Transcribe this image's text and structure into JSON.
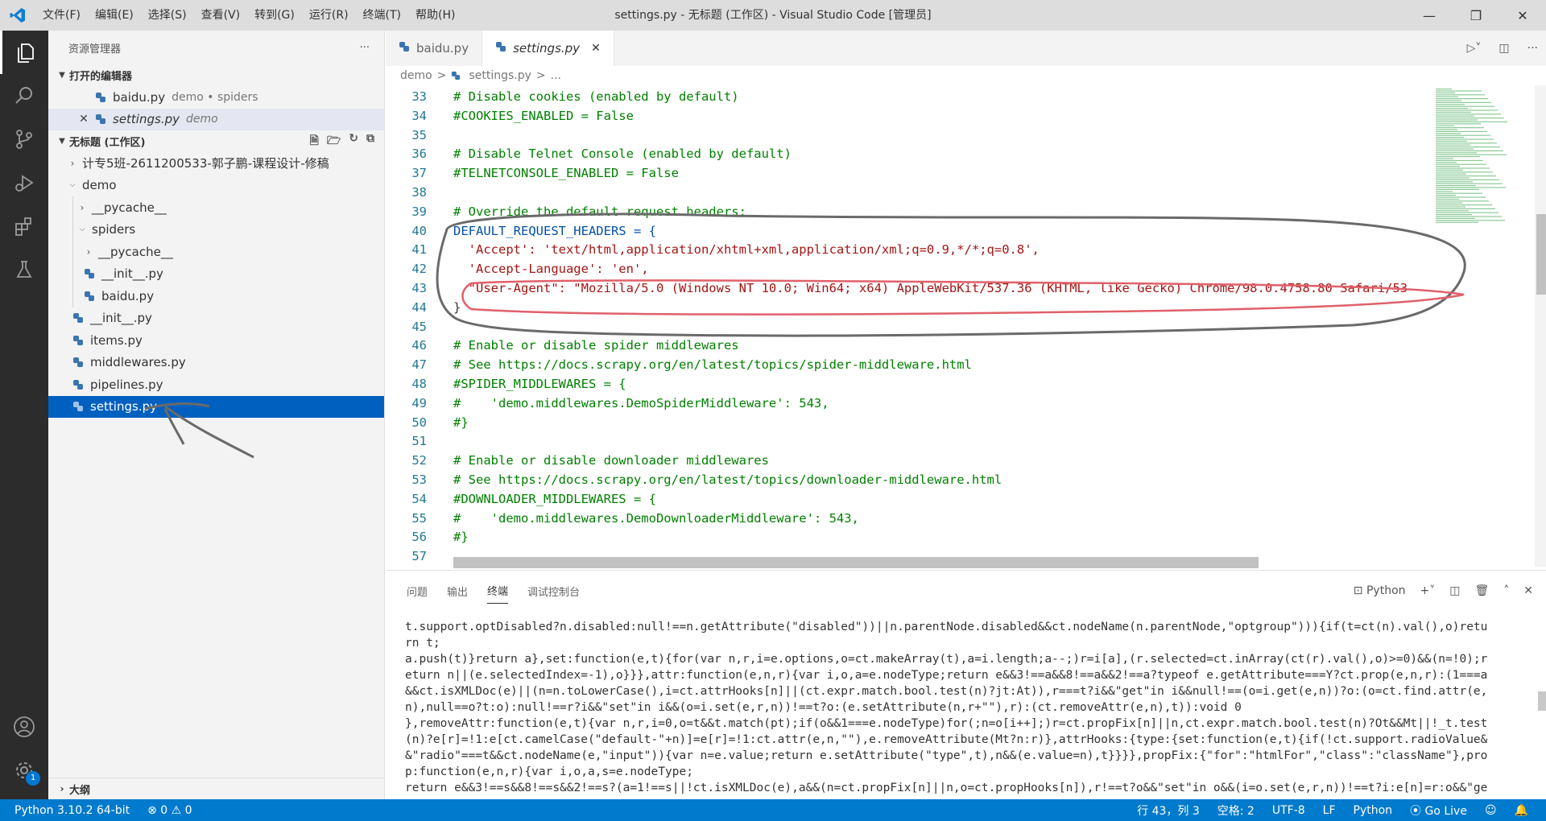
{
  "titlebar": {
    "menu": [
      "文件(F)",
      "编辑(E)",
      "选择(S)",
      "查看(V)",
      "转到(G)",
      "运行(R)",
      "终端(T)",
      "帮助(H)"
    ],
    "title": "settings.py - 无标题 (工作区) - Visual Studio Code [管理员]"
  },
  "activitybar": {
    "settings_badge": "1"
  },
  "sidebar": {
    "title": "资源管理器",
    "more": "···",
    "open_editors": {
      "header": "打开的编辑器",
      "items": [
        {
          "name": "baidu.py",
          "desc": "demo • spiders"
        },
        {
          "name": "settings.py",
          "desc": "demo"
        }
      ]
    },
    "workspace": {
      "header": "无标题 (工作区)",
      "items": [
        "计专5班-2611200533-郭子鹏-课程设计-修稿",
        "demo",
        "__pycache__",
        "spiders",
        "__pycache__",
        "__init__.py",
        "baidu.py",
        "__init__.py",
        "items.py",
        "middlewares.py",
        "pipelines.py",
        "settings.py"
      ]
    },
    "outline": "大纲"
  },
  "editor": {
    "tabs": [
      {
        "label": "baidu.py"
      },
      {
        "label": "settings.py",
        "close": "✕"
      }
    ],
    "breadcrumb": [
      "demo",
      ">",
      "settings.py",
      ">",
      "..."
    ],
    "lines": [
      {
        "n": "33",
        "t": "# Disable cookies (enabled by default)",
        "k": "cm"
      },
      {
        "n": "34",
        "t": "#COOKIES_ENABLED = False",
        "k": "cm"
      },
      {
        "n": "35",
        "t": "",
        "k": "cm"
      },
      {
        "n": "36",
        "t": "# Disable Telnet Console (enabled by default)",
        "k": "cm"
      },
      {
        "n": "37",
        "t": "#TELNETCONSOLE_ENABLED = False",
        "k": "cm"
      },
      {
        "n": "38",
        "t": "",
        "k": "cm"
      },
      {
        "n": "39",
        "t": "# Override the default request headers:",
        "k": "cm"
      },
      {
        "n": "40",
        "t": "DEFAULT_REQUEST_HEADERS = {",
        "k": "kw"
      },
      {
        "n": "41",
        "t": "  'Accept': 'text/html,application/xhtml+xml,application/xml;q=0.9,*/*;q=0.8',",
        "k": "str"
      },
      {
        "n": "42",
        "t": "  'Accept-Language': 'en',",
        "k": "str"
      },
      {
        "n": "43",
        "t": "  \"User-Agent\": \"Mozilla/5.0 (Windows NT 10.0; Win64; x64) AppleWebKit/537.36 (KHTML, like Gecko) Chrome/98.0.4758.80 Safari/53",
        "k": "str"
      },
      {
        "n": "44",
        "t": "}",
        "k": "pun"
      },
      {
        "n": "45",
        "t": "",
        "k": "cm"
      },
      {
        "n": "46",
        "t": "# Enable or disable spider middlewares",
        "k": "cm"
      },
      {
        "n": "47",
        "t": "# See https://docs.scrapy.org/en/latest/topics/spider-middleware.html",
        "k": "cm"
      },
      {
        "n": "48",
        "t": "#SPIDER_MIDDLEWARES = {",
        "k": "cm"
      },
      {
        "n": "49",
        "t": "#    'demo.middlewares.DemoSpiderMiddleware': 543,",
        "k": "cm"
      },
      {
        "n": "50",
        "t": "#}",
        "k": "cm"
      },
      {
        "n": "51",
        "t": "",
        "k": "cm"
      },
      {
        "n": "52",
        "t": "# Enable or disable downloader middlewares",
        "k": "cm"
      },
      {
        "n": "53",
        "t": "# See https://docs.scrapy.org/en/latest/topics/downloader-middleware.html",
        "k": "cm"
      },
      {
        "n": "54",
        "t": "#DOWNLOADER_MIDDLEWARES = {",
        "k": "cm"
      },
      {
        "n": "55",
        "t": "#    'demo.middlewares.DemoDownloaderMiddleware': 543,",
        "k": "cm"
      },
      {
        "n": "56",
        "t": "#}",
        "k": "cm"
      },
      {
        "n": "57",
        "t": "",
        "k": "cm"
      }
    ]
  },
  "panel": {
    "tabs": [
      "问题",
      "输出",
      "终端",
      "调试控制台"
    ],
    "active_tab": 2,
    "terminal_label": "Python",
    "terminal_lines": [
      "t.support.optDisabled?n.disabled:null!==n.getAttribute(\"disabled\"))||n.parentNode.disabled&&ct.nodeName(n.parentNode,\"optgroup\"))){if(t=ct(n).val(),o)retu",
      "rn t;",
      "a.push(t)}return a},set:function(e,t){for(var n,r,i=e.options,o=ct.makeArray(t),a=i.length;a--;)r=i[a],(r.selected=ct.inArray(ct(r).val(),o)>=0)&&(n=!0);r",
      "eturn n||(e.selectedIndex=-1),o}}},attr:function(e,n,r){var i,o,a=e.nodeType;return e&&3!==a&&8!==a&&2!==a?typeof e.getAttribute===Y?ct.prop(e,n,r):(1===a",
      "&&ct.isXMLDoc(e)||(n=n.toLowerCase(),i=ct.attrHooks[n]||(ct.expr.match.bool.test(n)?jt:At)),r===t?i&&\"get\"in i&&null!==(o=i.get(e,n))?o:(o=ct.find.attr(e,",
      "n),null==o?t:o):null!==r?i&&\"set\"in i&&(o=i.set(e,r,n))!==t?o:(e.setAttribute(n,r+\"\"),r):(ct.removeAttr(e,n),t)):void 0",
      "},removeAttr:function(e,t){var n,r,i=0,o=t&&t.match(pt);if(o&&1===e.nodeType)for(;n=o[i++];)r=ct.propFix[n]||n,ct.expr.match.bool.test(n)?Ot&&Mt||!_t.test",
      "(n)?e[r]=!1:e[ct.camelCase(\"default-\"+n)]=e[r]=!1:ct.attr(e,n,\"\"),e.removeAttribute(Mt?n:r)},attrHooks:{type:{set:function(e,t){if(!ct.support.radioValue&",
      "&\"radio\"===t&&ct.nodeName(e,\"input\")){var n=e.value;return e.setAttribute(\"type\",t),n&&(e.value=n),t}}}},propFix:{\"for\":\"htmlFor\",\"class\":\"className\"},pro",
      "p:function(e,n,r){var i,o,a,s=e.nodeType;",
      "return e&&3!==s&&8!==s&&2!==s?(a=1!==s||!ct.isXMLDoc(e),a&&(n=ct.propFix[n]||n,o=ct.propHooks[n]),r!==t?o&&\"set\"in o&&(i=o.set(e,r,n))!==t?i:e[n]=r:o&&\"ge"
    ]
  },
  "statusbar": {
    "interpreter": "Python 3.10.2 64-bit",
    "problems": "⊗ 0 ⚠ 0",
    "position": "行 43，列 3",
    "spaces": "空格: 2",
    "encoding": "UTF-8",
    "eol": "LF",
    "language": "Python",
    "golive": "Go Live"
  },
  "colors": {
    "accent": "#007acc",
    "selection": "#0060c0",
    "comment": "#008000",
    "keyword": "#0451a5",
    "string": "#a31515",
    "annotation_red": "#e0606a",
    "annotation_gray": "#777777"
  }
}
